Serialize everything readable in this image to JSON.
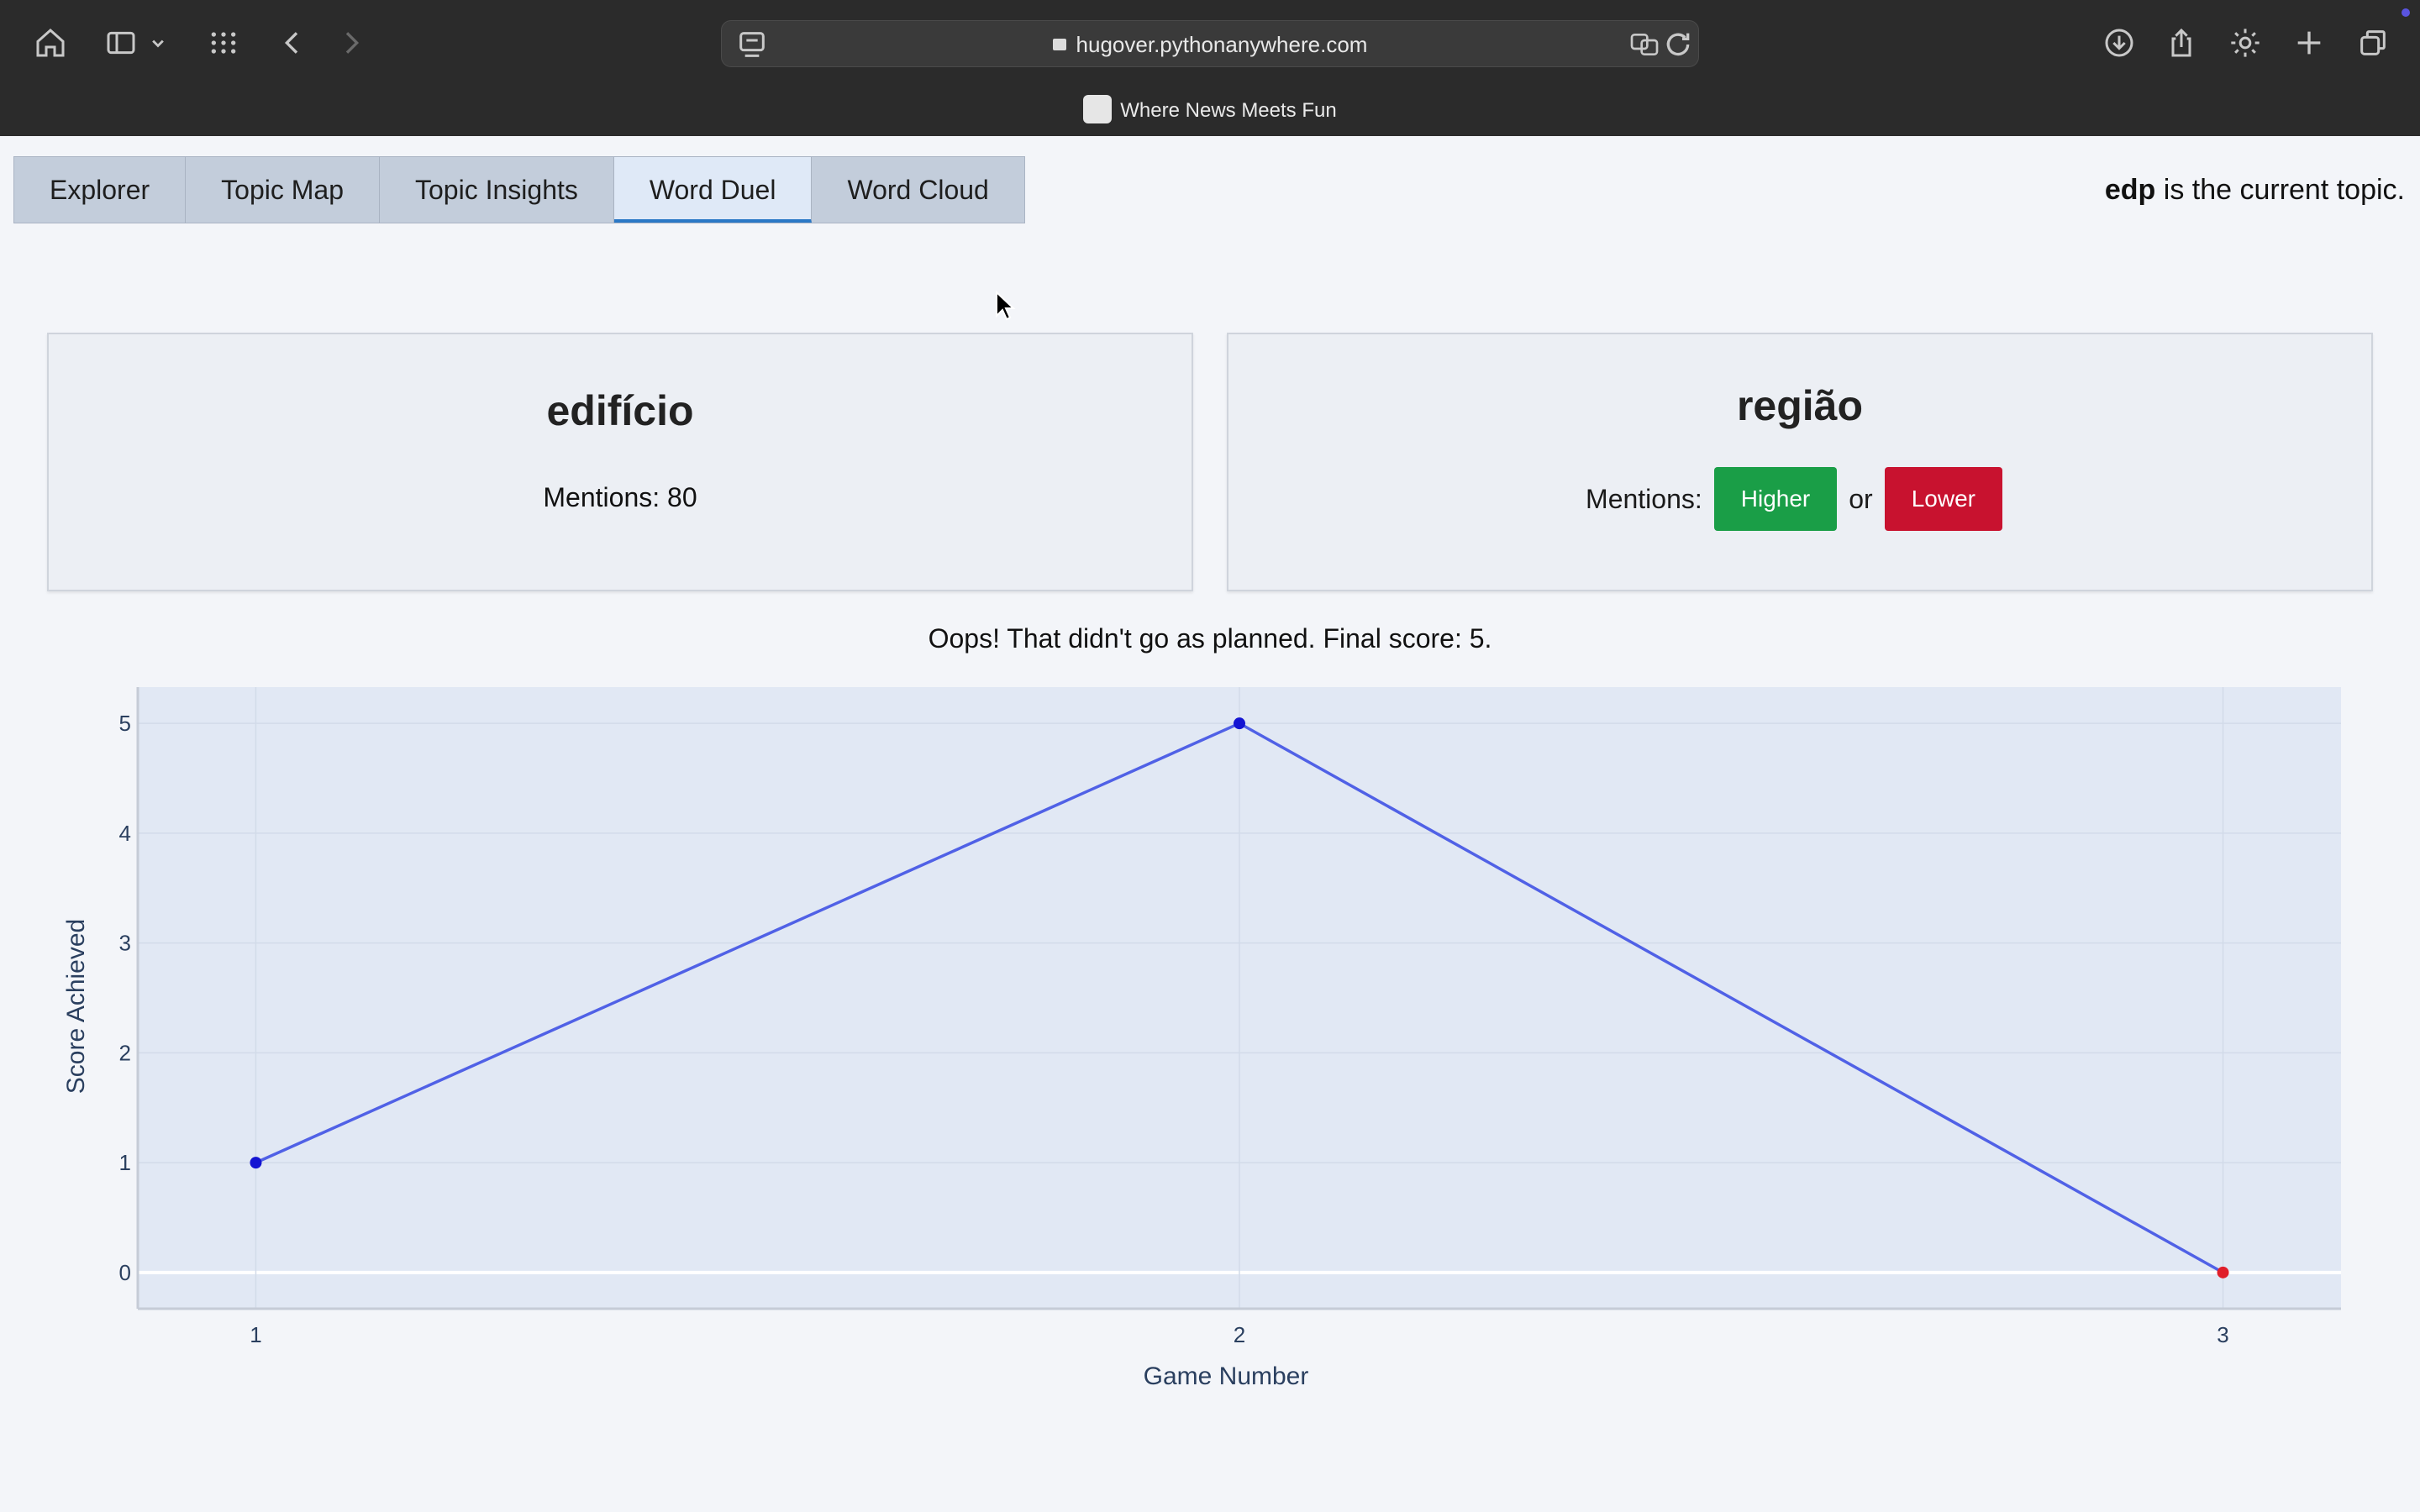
{
  "browser": {
    "url": "hugover.pythonanywhere.com",
    "tab_title": "Where News Meets Fun",
    "icons": [
      "home-icon",
      "sidebar-icon",
      "chevron-down-icon",
      "grid-icon",
      "back-icon",
      "forward-icon",
      "reader-icon",
      "lock-icon",
      "translate-icon",
      "reload-icon",
      "download-icon",
      "share-icon",
      "gear-icon",
      "plus-icon",
      "tabs-icon"
    ]
  },
  "nav": {
    "tabs": [
      "Explorer",
      "Topic Map",
      "Topic Insights",
      "Word Duel",
      "Word Cloud"
    ],
    "active": "Word Duel"
  },
  "topic": {
    "name": "edp",
    "suffix": " is the current topic."
  },
  "left_card": {
    "word": "edifício",
    "mentions": "Mentions: 80"
  },
  "right_card": {
    "word": "região",
    "mentions_label": "Mentions:",
    "higher": "Higher",
    "or": "or",
    "lower": "Lower"
  },
  "colors": {
    "higher": "#1a9e47",
    "lower": "#c8122f",
    "line": "#5061e6",
    "point": "#1414d2",
    "last_point": "#e01f2a",
    "plot_bg": "#e1e8f4"
  },
  "result_message": "Oops! That didn't go as planned. Final score: 5.",
  "chart_data": {
    "type": "line",
    "x": [
      1,
      2,
      3
    ],
    "y": [
      1,
      5,
      0
    ],
    "xlabel": "Game Number",
    "ylabel": "Score Achieved",
    "xticks": [
      "1",
      "2",
      "3"
    ],
    "yticks": [
      "0",
      "1",
      "2",
      "3",
      "4",
      "5"
    ],
    "ylim": [
      -0.33,
      5.33
    ],
    "xlim": [
      0.88,
      3.12
    ],
    "grid": true
  }
}
